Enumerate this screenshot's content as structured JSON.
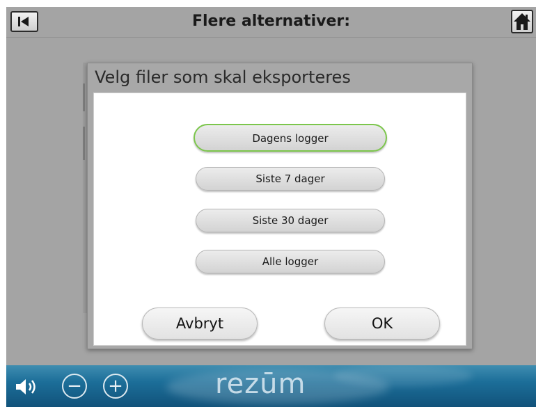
{
  "header": {
    "title": "Flere alternativer:",
    "back_icon": "skip-back-icon",
    "home_icon": "home-icon"
  },
  "dialog": {
    "title": "Velg filer som skal eksporteres",
    "options": [
      {
        "label": "Dagens logger",
        "selected": true
      },
      {
        "label": "Siste 7 dager",
        "selected": false
      },
      {
        "label": "Siste 30 dager",
        "selected": false
      },
      {
        "label": "Alle logger",
        "selected": false
      }
    ],
    "cancel_label": "Avbryt",
    "ok_label": "OK"
  },
  "footer": {
    "brand": "rezūm",
    "volume_icon": "speaker-icon",
    "minus_label": "−",
    "plus_label": "+"
  },
  "colors": {
    "background": "#a4a4a4",
    "selected_outline": "#7cc64c",
    "footer_blue": "#1c6e99"
  }
}
